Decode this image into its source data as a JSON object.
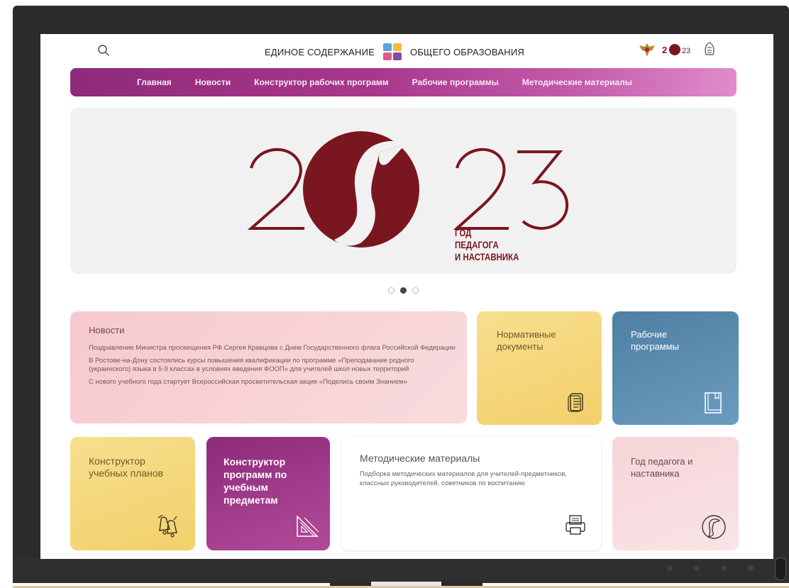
{
  "header": {
    "title_left": "ЕДИНОЕ СОДЕРЖАНИЕ",
    "title_right": "ОБЩЕГО ОБРАЗОВАНИЯ",
    "logo_colors": [
      "#5aa6d6",
      "#f4b93a",
      "#e25a8c",
      "#7b4fa0"
    ]
  },
  "nav": {
    "items": [
      {
        "label": "Главная"
      },
      {
        "label": "Новости"
      },
      {
        "label": "Конструктор рабочих программ"
      },
      {
        "label": "Рабочие программы"
      },
      {
        "label": "Методические материалы"
      }
    ]
  },
  "banner": {
    "digit_left": "20",
    "digit_right": "23",
    "caption": [
      "ГОД",
      "ПЕДАГОГА",
      "И НАСТАВНИКА"
    ],
    "color": "#7a1620",
    "slide_active": 2,
    "slide_count": 3
  },
  "tiles": {
    "news": {
      "title": "Новости",
      "items": [
        "Поздравление Министра просвещения РФ Сергея Кравцова с Днем Государственного флага Российской Федерации",
        "В Ростове-на-Дону состоялись курсы повышения квалификации по программе «Преподавание родного (украинского) языка в 5-9 классах в условиях введения ФООП» для учителей школ новых территорий",
        "С нового учебного года стартует Всероссийская просветительская акция «Поделись своим Знанием»"
      ]
    },
    "normative": {
      "title": "Нормативные документы",
      "icon": "document-icon"
    },
    "programs": {
      "title": "Рабочие программы",
      "icon": "book-icon"
    },
    "constructor_plans": {
      "title": "Конструктор учебных планов",
      "icon": "bells-icon"
    },
    "constructor_programs": {
      "title": "Конструктор программ по учебным предметам",
      "icon": "ruler-triangle-icon"
    },
    "method": {
      "title": "Методические материалы",
      "description": "Подборка методических материалов для учителей-предметников, классных руководителей, советников по воспитанию",
      "icon": "printer-icon"
    },
    "year": {
      "title": "Год педагога и наставника",
      "icon": "pelican-icon"
    }
  },
  "colors": {
    "nav_gradient_start": "#8e2a7a",
    "nav_gradient_end": "#e08ccc",
    "banner_accent": "#7a1620"
  }
}
